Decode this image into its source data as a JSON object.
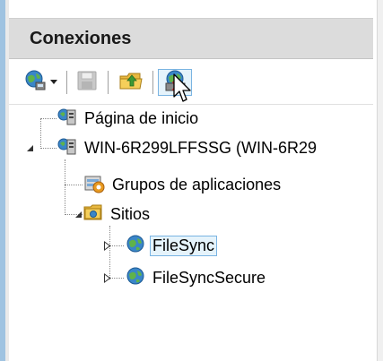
{
  "panel": {
    "title": "Conexiones"
  },
  "toolbar": {
    "buttons": [
      {
        "icon": "connect-globe-icon",
        "has_dropdown": true
      },
      {
        "icon": "save-icon",
        "disabled": true
      },
      {
        "icon": "up-folder-icon"
      },
      {
        "icon": "disconnect-icon"
      }
    ]
  },
  "tree": {
    "start_page": "Página de inicio",
    "server": "WIN-6R299LFFSSG (WIN-6R29",
    "app_pools": "Grupos de aplicaciones",
    "sites": "Sitios",
    "site1": "FileSync",
    "site2": "FileSyncSecure"
  },
  "colors": {
    "header_bg": "#dcdcdc",
    "selection_bg": "#e5f3fb",
    "selection_border": "#7ab4e2",
    "accent_border": "#9fc3e1"
  }
}
